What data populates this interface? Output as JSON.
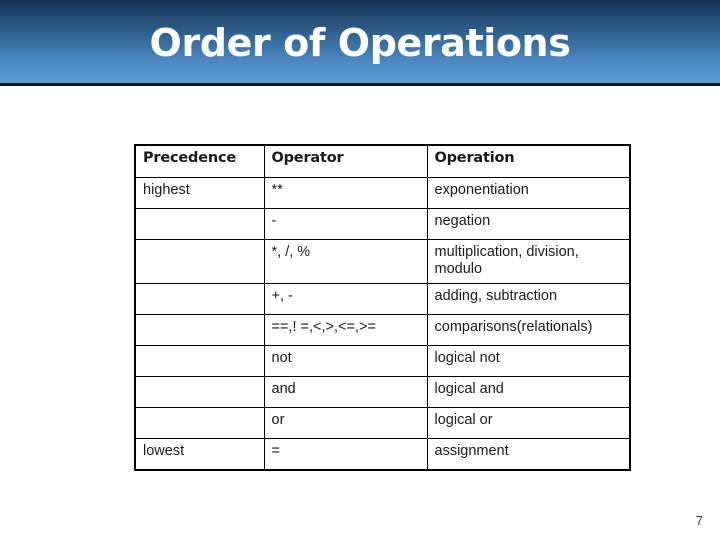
{
  "slide": {
    "title": "Order of Operations",
    "page_number": "7",
    "banner_gradient_top": "#1c3c5e",
    "banner_gradient_bottom": "#5a9bd0",
    "title_color": "#ffffff"
  },
  "table": {
    "headers": [
      "Precedence",
      "Operator",
      "Operation"
    ],
    "rows": [
      {
        "precedence": "highest",
        "operator": "**",
        "operation": "exponentiation"
      },
      {
        "precedence": "",
        "operator": "-",
        "operation": "negation"
      },
      {
        "precedence": "",
        "operator": "*, /, %",
        "operation": "multiplication, division, modulo"
      },
      {
        "precedence": "",
        "operator": "+, -",
        "operation": "adding, subtraction"
      },
      {
        "precedence": "",
        "operator": "==,! =,<,>,<=,>=",
        "operation": "comparisons(relationals)"
      },
      {
        "precedence": "",
        "operator": "not",
        "operation": "logical not"
      },
      {
        "precedence": "",
        "operator": "and",
        "operation": "logical and"
      },
      {
        "precedence": "",
        "operator": "or",
        "operation": "logical or"
      },
      {
        "precedence": "lowest",
        "operator": "=",
        "operation": "assignment"
      }
    ]
  }
}
